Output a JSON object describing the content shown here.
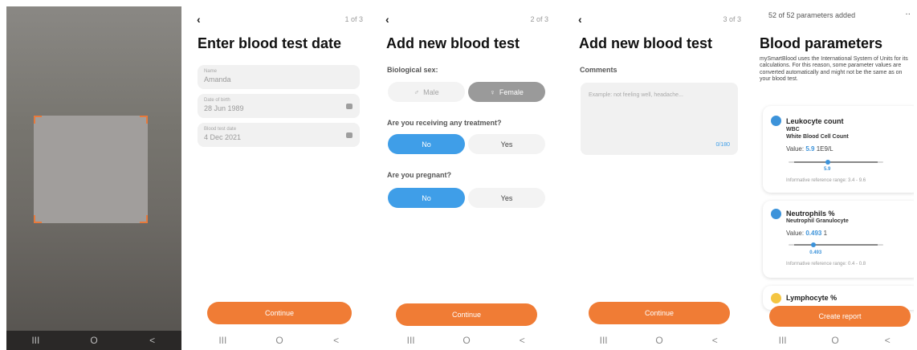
{
  "nav": {
    "recents": "III",
    "home": "O",
    "back": "<"
  },
  "scan_screen": {
    "viewfinder": "camera-viewfinder"
  },
  "screen1": {
    "step": "1 of 3",
    "title": "Enter blood test date",
    "name_label": "Name",
    "name_value": "Amanda",
    "dob_label": "Date of birth",
    "dob_value": "28 Jun 1989",
    "test_date_label": "Blood test date",
    "test_date_value": "4 Dec 2021",
    "continue": "Continue"
  },
  "screen2": {
    "step": "2 of 3",
    "title": "Add new blood test",
    "sex_label": "Biological sex:",
    "male": "Male",
    "female": "Female",
    "treatment_q": "Are you receiving any treatment?",
    "pregnant_q": "Are you pregnant?",
    "no": "No",
    "yes": "Yes",
    "continue": "Continue",
    "selected": {
      "sex": "Female",
      "treatment": "No",
      "pregnant": "No"
    }
  },
  "screen3": {
    "step": "3 of 3",
    "title": "Add new blood test",
    "comments_label": "Comments",
    "comments_placeholder": "Example: not feeling well, headache...",
    "counter": "0/180",
    "continue": "Continue"
  },
  "screen4": {
    "added": "52 of 52 parameters added",
    "more": "··",
    "title": "Blood parameters",
    "intro": "mySmartBlood uses the International System of Units for its calculations. For this reason, some parameter values are converted automatically and might not be the same as on your blood test.",
    "params": [
      {
        "name": "Leukocyte count",
        "abbr": "WBC",
        "full": "White Blood Cell Count",
        "value_prefix": "Value:",
        "value": "5.9",
        "unit": "1E9/L",
        "value_level": 5.9,
        "range_min": 3.4,
        "range_max": 9.6,
        "range_text": "Informative reference range: 3.4 - 9.6"
      },
      {
        "name": "Neutrophils %",
        "full": "Neutrophil Granulocyte",
        "value_prefix": "Value:",
        "value": "0.493",
        "unit": "1",
        "value_level": 0.493,
        "range_min": 0.4,
        "range_max": 0.8,
        "range_text": "Informative reference range: 0.4 - 0.8"
      },
      {
        "name": "Lymphocyte %"
      }
    ],
    "create_report": "Create report"
  },
  "colors": {
    "accent": "#f07c35",
    "primary_blue": "#3f9ee8",
    "camera_frame": "#e87a3c"
  }
}
